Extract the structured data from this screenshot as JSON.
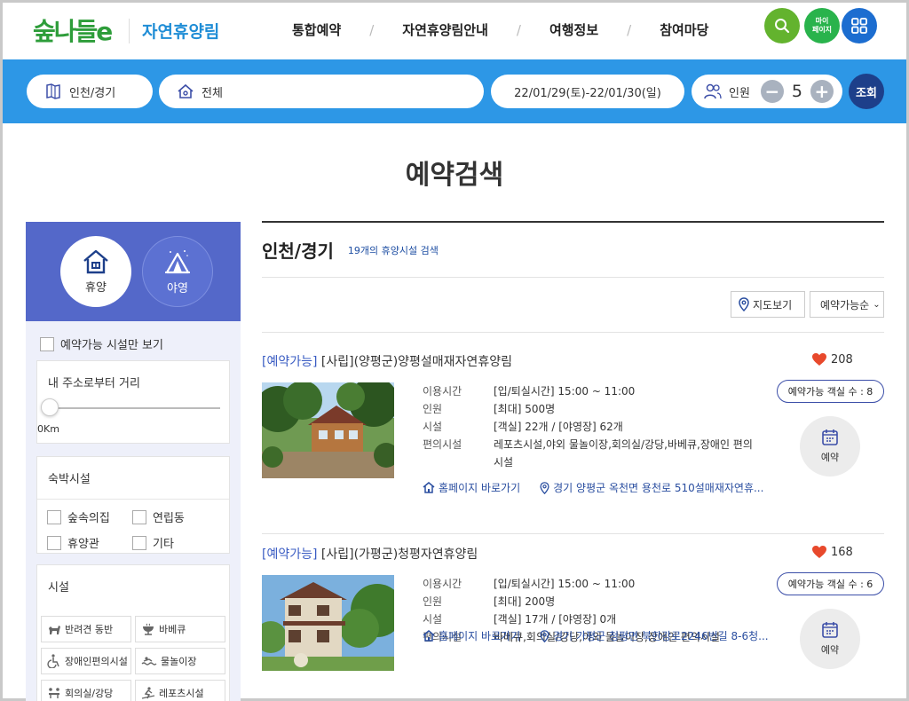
{
  "header": {
    "logo_text": "숲나들e",
    "site_name": "자연휴양림",
    "nav": [
      "통합예약",
      "자연휴양림안내",
      "여행정보",
      "참여마당"
    ],
    "mypage_line1": "마이",
    "mypage_line2": "페이지",
    "colors": {
      "search": "#63b32e",
      "mypage": "#29b34c",
      "grid": "#1c6dd0"
    }
  },
  "searchbar": {
    "region": "인천/경기",
    "area": "전체",
    "dates": "22/01/29(토)-22/01/30(일)",
    "people_label": "인원",
    "people_count": "5",
    "minus": "−",
    "plus": "+",
    "query_label": "조회",
    "bg_color": "#2d97e6"
  },
  "page_title": "예약검색",
  "sidebar": {
    "types": [
      {
        "label": "휴양",
        "icon": "house-icon",
        "selected": true
      },
      {
        "label": "야영",
        "icon": "tent-icon",
        "selected": false
      }
    ],
    "available_only": "예약가능 시설만 보기",
    "distance": {
      "title": "내 주소로부터 거리",
      "value": "0Km",
      "level": 0
    },
    "lodging": {
      "title": "숙박시설",
      "options": [
        "숲속의집",
        "연립동",
        "휴양관",
        "기타"
      ]
    },
    "facilities": {
      "title": "시설",
      "options": [
        {
          "label": "반려견 동반",
          "icon": "dog-icon"
        },
        {
          "label": "바베큐",
          "icon": "grill-icon"
        },
        {
          "label": "장애인편의시설",
          "icon": "wheelchair-icon"
        },
        {
          "label": "물놀이장",
          "icon": "water-icon"
        },
        {
          "label": "회의실/강당",
          "icon": "meeting-icon"
        },
        {
          "label": "레포츠시설",
          "icon": "sports-icon"
        }
      ]
    }
  },
  "results": {
    "region_title": "인천/경기",
    "count_text": "19개의 휴양시설 검색",
    "map_view": "지도보기",
    "sort_label": "예약가능순",
    "items": [
      {
        "status": "[예약가능]",
        "name": "[사립](양평군)양평설매재자연휴양림",
        "likes": "208",
        "info": [
          {
            "label": "이용시간",
            "value": "[입/퇴실시간] 15:00 ~ 11:00"
          },
          {
            "label": "인원",
            "value": "[최대] 500명"
          },
          {
            "label": "시설",
            "value": "[객실] 22개 / [야영장] 62개"
          },
          {
            "label": "편의시설",
            "value": "레포츠시설,야외 물놀이장,회의실/강당,바베큐,장애인 편의시설"
          }
        ],
        "homepage": "홈페이지 바로가기",
        "address": "경기 양평군 옥천면 용천로 510설매재자연휴...",
        "rooms": "예약가능 객실 수 : 8",
        "book": "예약"
      },
      {
        "status": "[예약가능]",
        "name": "[사립](가평군)청평자연휴양림",
        "likes": "168",
        "info": [
          {
            "label": "이용시간",
            "value": "[입/퇴실시간] 15:00 ~ 11:00"
          },
          {
            "label": "인원",
            "value": "[최대] 200명"
          },
          {
            "label": "시설",
            "value": "[객실] 17개 / [야영장] 0개"
          },
          {
            "label": "편의시설",
            "value": "바베큐,회의실/강당,야외 물놀이장,장애인 편의시설"
          }
        ],
        "homepage": "홈페이지 바로가기",
        "address": "경기 가평군 청평면 북한강로2246번길 8-6청...",
        "rooms": "예약가능 객실 수 : 6",
        "book": "예약"
      }
    ]
  }
}
